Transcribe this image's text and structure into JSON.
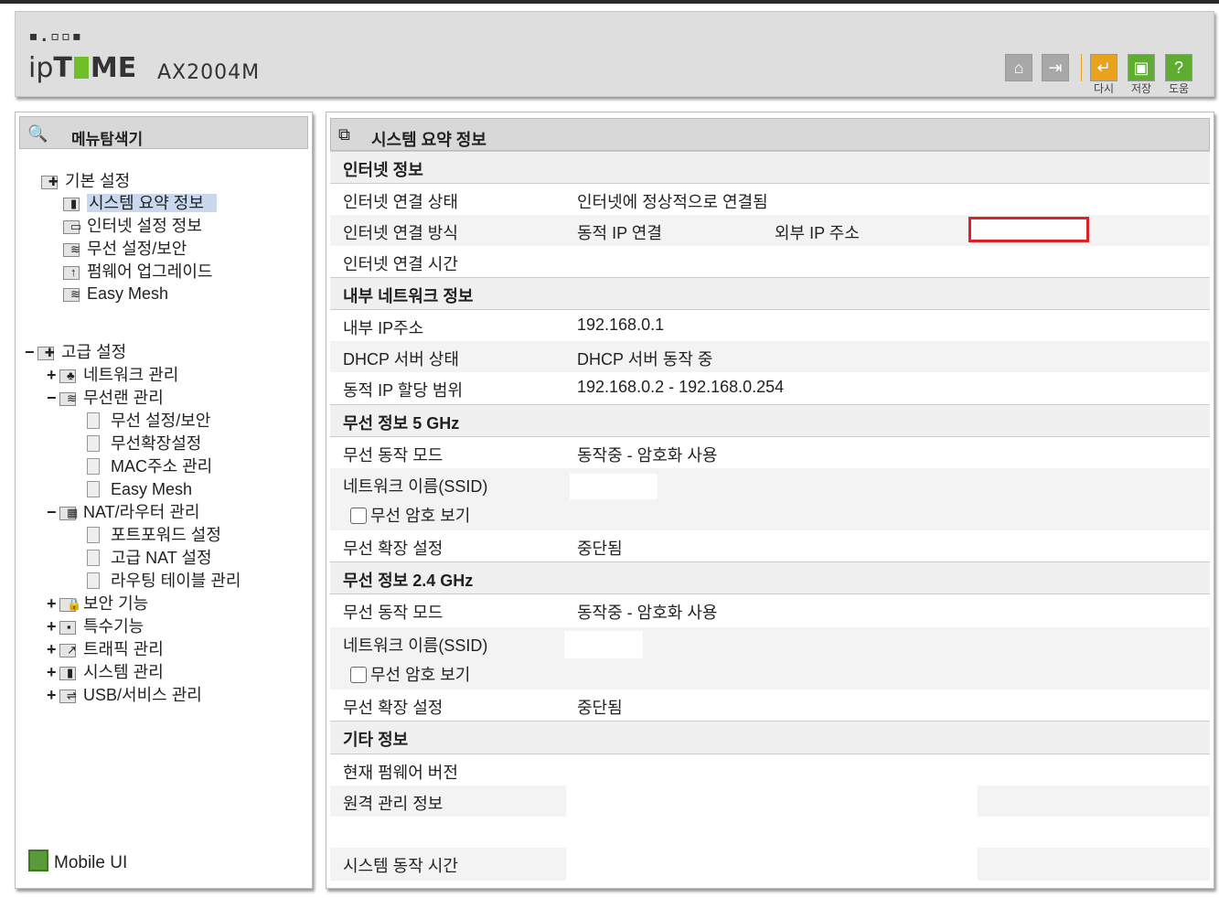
{
  "header": {
    "logo_dots": "▪.▫▫▪",
    "logo_ip": "ip",
    "logo_t": "T",
    "logo_me": "ME",
    "model": "AX2004M",
    "buttons": [
      {
        "icon": "home-icon",
        "glyph": "⌂",
        "label": ""
      },
      {
        "icon": "logout-icon",
        "glyph": "⇥",
        "label": ""
      },
      {
        "icon": "refresh-icon",
        "glyph": "↵",
        "label": "다시"
      },
      {
        "icon": "save-icon",
        "glyph": "▣",
        "label": "저장"
      },
      {
        "icon": "help-icon",
        "glyph": "?",
        "label": "도움"
      }
    ]
  },
  "sidebar": {
    "title": "메뉴탐색기",
    "basic": {
      "label": "기본 설정",
      "items": [
        "시스템 요약 정보",
        "인터넷 설정 정보",
        "무선 설정/보안",
        "펌웨어 업그레이드",
        "Easy Mesh"
      ]
    },
    "advanced": {
      "label": "고급 설정",
      "toggle": "−",
      "groups": [
        {
          "toggle": "+",
          "label": "네트워크 관리"
        },
        {
          "toggle": "−",
          "label": "무선랜 관리",
          "children": [
            "무선 설정/보안",
            "무선확장설정",
            "MAC주소 관리",
            "Easy Mesh"
          ]
        },
        {
          "toggle": "−",
          "label": "NAT/라우터 관리",
          "children": [
            "포트포워드 설정",
            "고급 NAT 설정",
            "라우팅 테이블 관리"
          ]
        },
        {
          "toggle": "+",
          "label": "보안 기능"
        },
        {
          "toggle": "+",
          "label": "특수기능"
        },
        {
          "toggle": "+",
          "label": "트래픽 관리"
        },
        {
          "toggle": "+",
          "label": "시스템 관리"
        },
        {
          "toggle": "+",
          "label": "USB/서비스 관리"
        }
      ]
    },
    "mobile_ui": "Mobile UI"
  },
  "main": {
    "title": "시스템 요약 정보",
    "internet": {
      "section": "인터넷 정보",
      "status_label": "인터넷 연결 상태",
      "status_value": "인터넷에 정상적으로 연결됨",
      "method_label": "인터넷 연결 방식",
      "method_value": "동적 IP 연결",
      "external_ip_label": "외부 IP 주소",
      "time_label": "인터넷 연결 시간"
    },
    "lan": {
      "section": "내부 네트워크 정보",
      "ip_label": "내부 IP주소",
      "ip_value": "192.168.0.1",
      "dhcp_label": "DHCP 서버 상태",
      "dhcp_value": "DHCP 서버 동작 중",
      "range_label": "동적 IP 할당 범위",
      "range_value": "192.168.0.2 -  192.168.0.254"
    },
    "wifi5": {
      "section": "무선 정보 5 GHz",
      "mode_label": "무선 동작 모드",
      "mode_value": "동작중 - 암호화 사용",
      "ssid_label": "네트워크 이름(SSID)",
      "show_pw_label": "무선 암호 보기",
      "ext_label": "무선 확장 설정",
      "ext_value": "중단됨"
    },
    "wifi24": {
      "section": "무선 정보 2.4 GHz",
      "mode_label": "무선 동작 모드",
      "mode_value": "동작중 - 암호화 사용",
      "ssid_label": "네트워크 이름(SSID)",
      "show_pw_label": "무선 암호 보기",
      "ext_label": "무선 확장 설정",
      "ext_value": "중단됨"
    },
    "etc": {
      "section": "기타 정보",
      "fw_label": "현재 펌웨어 버전",
      "remote_label": "원격 관리 정보",
      "uptime_label": "시스템 동작 시간"
    }
  }
}
